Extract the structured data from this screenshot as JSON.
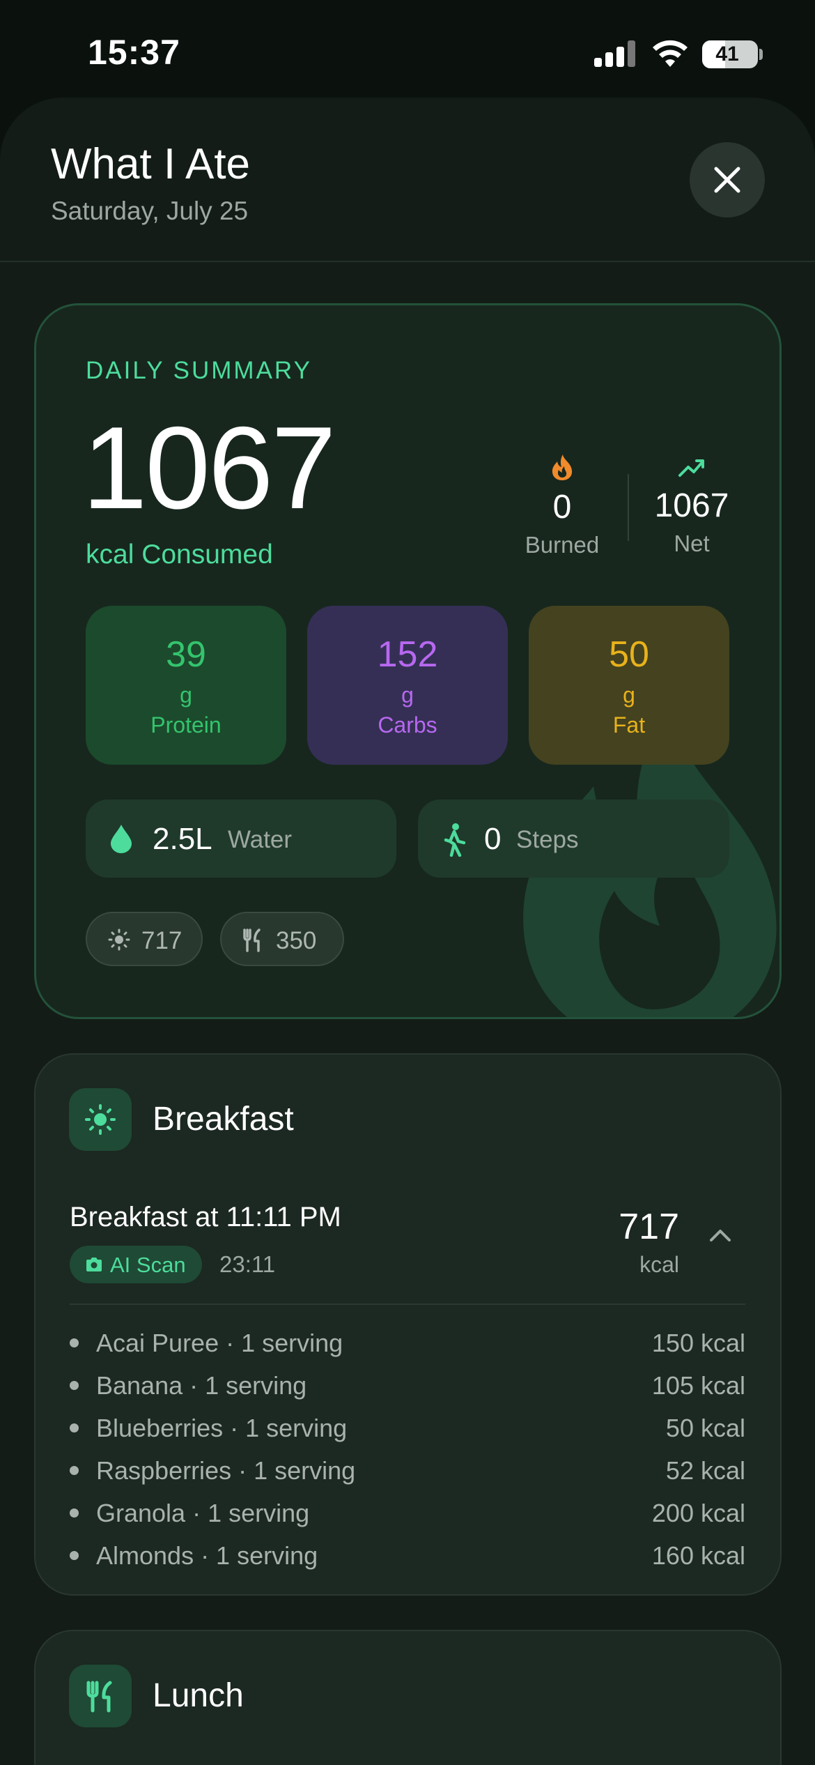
{
  "status_bar": {
    "time": "15:37",
    "battery": "41",
    "battery_level": 0.41
  },
  "header": {
    "title": "What I Ate",
    "date": "Saturday, July 25"
  },
  "summary": {
    "label": "DAILY SUMMARY",
    "kcal_consumed": "1067",
    "kcal_label": "kcal Consumed",
    "burned_value": "0",
    "burned_label": "Burned",
    "net_value": "1067",
    "net_label": "Net",
    "macros": [
      {
        "value": "39",
        "unit": "g",
        "label": "Protein",
        "color": "#34c46e",
        "bg": "#1c4a2c"
      },
      {
        "value": "152",
        "unit": "g",
        "label": "Carbs",
        "color": "#b768f0",
        "bg": "#352f55"
      },
      {
        "value": "50",
        "unit": "g",
        "label": "Fat",
        "color": "#e8b21b",
        "bg": "#44421f"
      }
    ],
    "water": {
      "value": "2.5L",
      "label": "Water"
    },
    "steps": {
      "value": "0",
      "label": "Steps"
    },
    "chips": [
      {
        "icon": "sun-icon",
        "text": "717"
      },
      {
        "icon": "fork-knife-icon",
        "text": "350"
      }
    ]
  },
  "meals": [
    {
      "name": "Breakfast",
      "icon": "sun-icon",
      "entry": {
        "title": "Breakfast at 11:11 PM",
        "source": "AI Scan",
        "time": "23:11",
        "kcal": "717",
        "kcal_unit": "kcal",
        "items": [
          {
            "name": "Acai Puree · 1 serving",
            "kcal": "150 kcal"
          },
          {
            "name": "Banana · 1 serving",
            "kcal": "105 kcal"
          },
          {
            "name": "Blueberries · 1 serving",
            "kcal": "50 kcal"
          },
          {
            "name": "Raspberries · 1 serving",
            "kcal": "52 kcal"
          },
          {
            "name": "Granola · 1 serving",
            "kcal": "200 kcal"
          },
          {
            "name": "Almonds · 1 serving",
            "kcal": "160 kcal"
          }
        ]
      }
    },
    {
      "name": "Lunch",
      "icon": "fork-knife-icon"
    }
  ],
  "colors": {
    "accent": "#4ddc9c",
    "burned": "#f08a2c",
    "background": "#0b120e"
  }
}
